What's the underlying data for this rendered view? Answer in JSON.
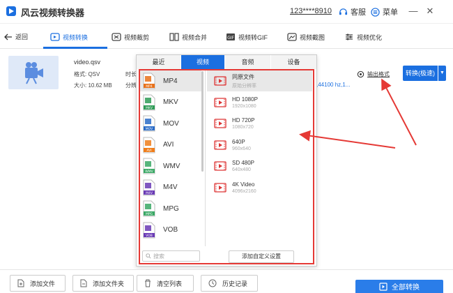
{
  "app": {
    "title": "风云视频转换器",
    "phone": "123****8910",
    "service": "客服",
    "menu": "菜单"
  },
  "nav": {
    "back": "返回",
    "items": [
      {
        "label": "视频转换",
        "icon": "video-convert-icon"
      },
      {
        "label": "视频裁剪",
        "icon": "video-crop-icon"
      },
      {
        "label": "视频合并",
        "icon": "video-merge-icon"
      },
      {
        "label": "视频转GIF",
        "icon": "gif-icon"
      },
      {
        "label": "视频截图",
        "icon": "screenshot-icon"
      },
      {
        "label": "视频优化",
        "icon": "optimize-icon"
      }
    ],
    "active_index": 0
  },
  "file": {
    "name": "video.qsv",
    "format": "格式: QSV",
    "size": "大小: 10.62 MB",
    "duration_label": "时长",
    "resolution_label": "分辨",
    "audio": ",44100 hz,1...",
    "output_format_label": "输出格式",
    "convert_label": "转换(极速)"
  },
  "panel": {
    "tabs": [
      "最近",
      "视频",
      "音频",
      "设备"
    ],
    "active_tab": 1,
    "formats": [
      {
        "label": "MP4",
        "badge": "MP4",
        "color": "#e8711a"
      },
      {
        "label": "MKV",
        "badge": "MKV",
        "color": "#2e9b56"
      },
      {
        "label": "MOV",
        "badge": "MOV",
        "color": "#2a6bc7"
      },
      {
        "label": "AVI",
        "badge": "AVI",
        "color": "#ef7d1a"
      },
      {
        "label": "WMV",
        "badge": "WMV",
        "color": "#3aa865"
      },
      {
        "label": "M4V",
        "badge": "M4V",
        "color": "#6a3bb5"
      },
      {
        "label": "MPG",
        "badge": "MPG",
        "color": "#3aa865"
      },
      {
        "label": "VOB",
        "badge": "VOB",
        "color": "#6a3bb5"
      }
    ],
    "selected_format": 0,
    "resolutions": [
      {
        "title": "同原文件",
        "sub": "原始分辨率"
      },
      {
        "title": "HD 1080P",
        "sub": "1920x1080"
      },
      {
        "title": "HD 720P",
        "sub": "1080x720"
      },
      {
        "title": "640P",
        "sub": "960x640"
      },
      {
        "title": "SD 480P",
        "sub": "640x480"
      },
      {
        "title": "4K Video",
        "sub": "4096x2160"
      }
    ],
    "selected_resolution": 0,
    "search_placeholder": "搜索",
    "custom_label": "添加自定义设置"
  },
  "bottom": {
    "buttons": [
      "添加文件",
      "添加文件夹",
      "清空列表",
      "历史记录"
    ],
    "convert_all": "全部转换"
  },
  "colors": {
    "accent": "#1b6fe0",
    "highlight": "#e53935"
  }
}
